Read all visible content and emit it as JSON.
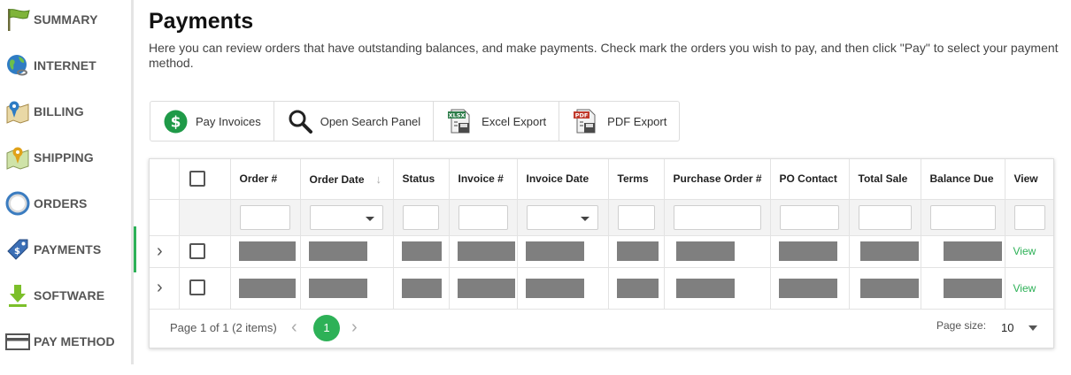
{
  "sidebar": {
    "items": [
      {
        "label": "SUMMARY",
        "icon": "flag-icon"
      },
      {
        "label": "INTERNET",
        "icon": "globe-icon"
      },
      {
        "label": "BILLING",
        "icon": "map-pin-icon"
      },
      {
        "label": "SHIPPING",
        "icon": "map-icon"
      },
      {
        "label": "ORDERS",
        "icon": "compass-icon"
      },
      {
        "label": "PAYMENTS",
        "icon": "price-tag-icon",
        "active": true
      },
      {
        "label": "SOFTWARE",
        "icon": "download-icon"
      },
      {
        "label": "PAY METHOD",
        "icon": "credit-card-icon"
      }
    ]
  },
  "page": {
    "title": "Payments",
    "description": "Here you can review orders that have outstanding balances, and make payments. Check mark the orders you wish to pay, and then click \"Pay\" to select your payment method."
  },
  "toolbar": {
    "pay_invoices": "Pay Invoices",
    "open_search_panel": "Open Search Panel",
    "excel_export": "Excel Export",
    "pdf_export": "PDF Export",
    "excel_badge": "XLSX",
    "pdf_badge": "PDF"
  },
  "grid": {
    "columns": [
      "Order #",
      "Order Date",
      "Status",
      "Invoice #",
      "Invoice Date",
      "Terms",
      "Purchase Order #",
      "PO Contact",
      "Total Sale",
      "Balance Due",
      "View"
    ],
    "sorted_column": "Order Date",
    "sort_direction": "descending",
    "rows": [
      {
        "view": "View"
      },
      {
        "view": "View"
      }
    ]
  },
  "pager": {
    "info": "Page 1 of 1 (2 items)",
    "current_page": "1",
    "page_size_label": "Page size:",
    "page_size": "10"
  },
  "colors": {
    "accent": "#2db157",
    "redacted": "#7f7f7f"
  }
}
